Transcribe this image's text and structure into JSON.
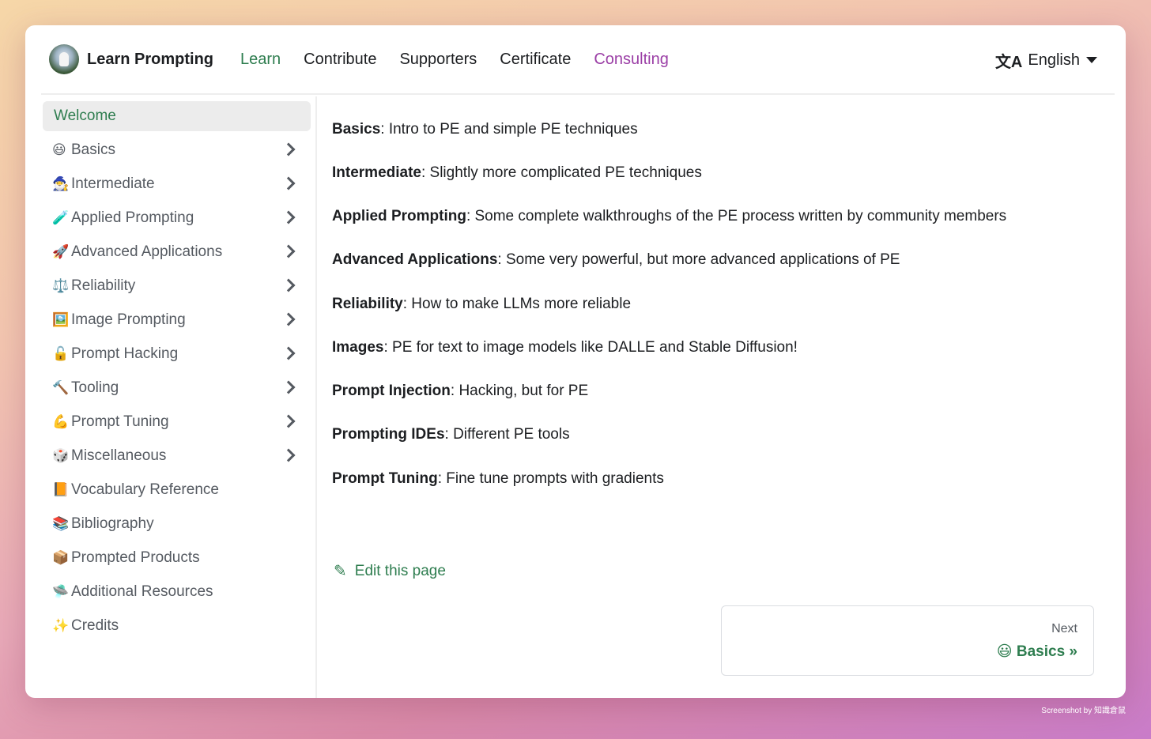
{
  "navbar": {
    "brand": "Learn Prompting",
    "links": [
      "Learn",
      "Contribute",
      "Supporters",
      "Certificate",
      "Consulting"
    ],
    "language": "English",
    "language_icon": "translate-icon"
  },
  "sidebar": {
    "items": [
      {
        "emoji": "",
        "label": "Welcome",
        "active": true,
        "expandable": false
      },
      {
        "emoji": "😃",
        "label": "Basics",
        "expandable": true
      },
      {
        "emoji": "🧙‍♂️",
        "label": "Intermediate",
        "expandable": true
      },
      {
        "emoji": "🧪",
        "label": "Applied Prompting",
        "expandable": true
      },
      {
        "emoji": "🚀",
        "label": "Advanced Applications",
        "expandable": true
      },
      {
        "emoji": "⚖️",
        "label": "Reliability",
        "expandable": true
      },
      {
        "emoji": "🖼️",
        "label": "Image Prompting",
        "expandable": true
      },
      {
        "emoji": "🔓",
        "label": "Prompt Hacking",
        "expandable": true
      },
      {
        "emoji": "🔨",
        "label": "Tooling",
        "expandable": true
      },
      {
        "emoji": "💪",
        "label": "Prompt Tuning",
        "expandable": true
      },
      {
        "emoji": "🎲",
        "label": "Miscellaneous",
        "expandable": true
      },
      {
        "emoji": "📙",
        "label": "Vocabulary Reference",
        "expandable": false
      },
      {
        "emoji": "📚",
        "label": "Bibliography",
        "expandable": false
      },
      {
        "emoji": "📦",
        "label": "Prompted Products",
        "expandable": false
      },
      {
        "emoji": "🛸",
        "label": "Additional Resources",
        "expandable": false
      },
      {
        "emoji": "✨",
        "label": "Credits",
        "expandable": false
      }
    ]
  },
  "main": {
    "descriptions": [
      {
        "term": "Basics",
        "text": ": Intro to PE and simple PE techniques"
      },
      {
        "term": "Intermediate",
        "text": ": Slightly more complicated PE techniques"
      },
      {
        "term": "Applied Prompting",
        "text": ": Some complete walkthroughs of the PE process written by community members"
      },
      {
        "term": "Advanced Applications",
        "text": ": Some very powerful, but more advanced applications of PE"
      },
      {
        "term": "Reliability",
        "text": ": How to make LLMs more reliable"
      },
      {
        "term": "Images",
        "text": ": PE for text to image models like DALLE and Stable Diffusion!"
      },
      {
        "term": "Prompt Injection",
        "text": ": Hacking, but for PE"
      },
      {
        "term": "Prompting IDEs",
        "text": ": Different PE tools"
      },
      {
        "term": "Prompt Tuning",
        "text": ": Fine tune prompts with gradients"
      }
    ],
    "edit_link": "Edit this page",
    "pager": {
      "sublabel": "Next",
      "label": "😃 Basics »"
    }
  },
  "footer_credit": "Screenshot by 知識倉鼠",
  "colors": {
    "accent": "#2e7d4f",
    "consulting": "#9b3fa6"
  }
}
